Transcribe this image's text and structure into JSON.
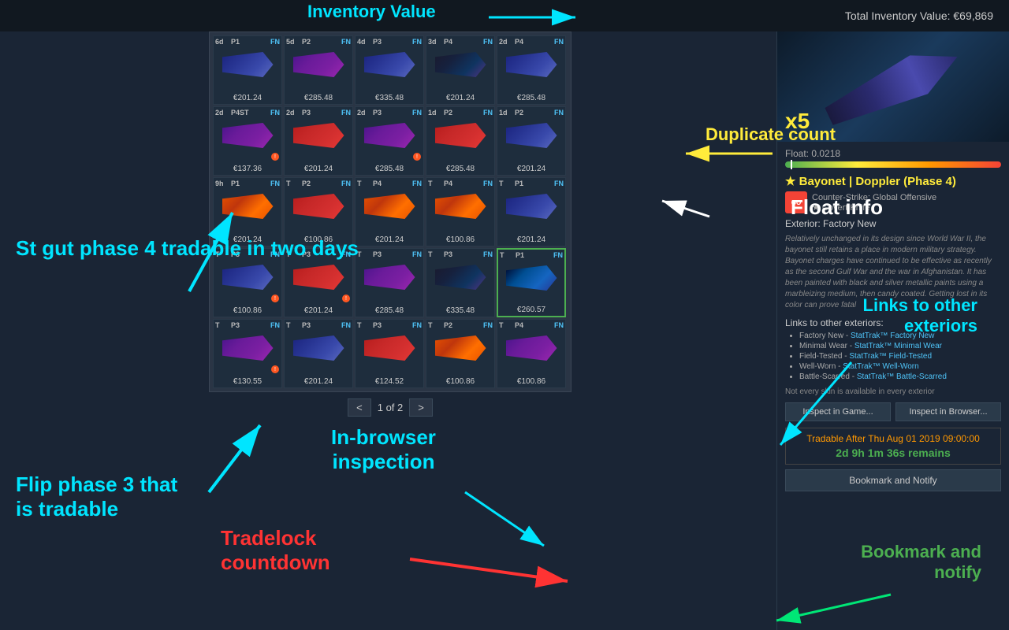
{
  "header": {
    "title": "Total Inventory Value: €69,869"
  },
  "annotations": {
    "inventory_value": "Inventory Value",
    "duplicate_count": "Duplicate count",
    "float_info": "Float info",
    "links_to_other": "Links to other\nexteriors",
    "st_gut": "St gut phase 4 tradable in two days",
    "flip_phase": "Flip phase 3 that\nis tradable",
    "inspection": "In-browser\ninspection",
    "tradelock": "Tradelock\ncountdown",
    "bookmark": "Bookmark and\nnotify"
  },
  "inventory": {
    "page_current": 1,
    "page_total": 2,
    "prev_label": "<",
    "next_label": ">",
    "items": [
      {
        "time": "6d",
        "phase": "P1",
        "wear": "FN",
        "price": "€201.24",
        "color": "blue"
      },
      {
        "time": "5d",
        "phase": "P2",
        "wear": "FN",
        "price": "€285.48",
        "color": "purple"
      },
      {
        "time": "4d",
        "phase": "P3",
        "wear": "FN",
        "price": "€335.48",
        "color": "blue"
      },
      {
        "time": "3d",
        "phase": "P4",
        "wear": "FN",
        "price": "€201.24",
        "color": "dark"
      },
      {
        "time": "2d",
        "phase": "P4",
        "wear": "FN",
        "price": "€285.48",
        "color": "blue"
      },
      {
        "time": "2d",
        "phase": "P4",
        "wear": "STFN",
        "price": "€137.36",
        "color": "purple",
        "warning": true
      },
      {
        "time": "2d",
        "phase": "P3",
        "wear": "FN",
        "price": "€201.24",
        "color": "red"
      },
      {
        "time": "2d",
        "phase": "P3",
        "wear": "FN",
        "price": "€285.48",
        "color": "purple",
        "warning": true
      },
      {
        "time": "1d",
        "phase": "P2",
        "wear": "FN",
        "price": "€285.48",
        "color": "red"
      },
      {
        "time": "1d",
        "phase": "P2",
        "wear": "FN",
        "price": "€201.24",
        "color": "blue"
      },
      {
        "time": "9h",
        "phase": "P1",
        "wear": "FN",
        "price": "€201.24",
        "color": "orange"
      },
      {
        "time": "T",
        "phase": "P2",
        "wear": "FN",
        "price": "€100.86",
        "color": "red"
      },
      {
        "time": "T",
        "phase": "P4",
        "wear": "FN",
        "price": "€201.24",
        "color": "orange"
      },
      {
        "time": "T",
        "phase": "P4",
        "wear": "FN",
        "price": "€100.86",
        "color": "orange"
      },
      {
        "time": "T",
        "phase": "P1",
        "wear": "FN",
        "price": "€201.24",
        "color": "blue"
      },
      {
        "time": "T",
        "phase": "P3",
        "wear": "FN",
        "price": "€100.86",
        "color": "blue",
        "warning": true
      },
      {
        "time": "T",
        "phase": "P3",
        "wear": "FN",
        "price": "€201.24",
        "color": "red",
        "warning": true
      },
      {
        "time": "T",
        "phase": "P3",
        "wear": "FN",
        "price": "€285.48",
        "color": "purple"
      },
      {
        "time": "T",
        "phase": "P3",
        "wear": "FN",
        "price": "€335.48",
        "color": "dark"
      },
      {
        "time": "T",
        "phase": "P1",
        "wear": "FN",
        "price": "€260.57",
        "color": "doppler",
        "selected": true
      },
      {
        "time": "T",
        "phase": "P3",
        "wear": "FN",
        "price": "€130.55",
        "color": "purple",
        "warning": true
      },
      {
        "time": "T",
        "phase": "P3",
        "wear": "FN",
        "price": "€201.24",
        "color": "blue"
      },
      {
        "time": "T",
        "phase": "P3",
        "wear": "FN",
        "price": "€124.52",
        "color": "red"
      },
      {
        "time": "T",
        "phase": "P2",
        "wear": "FN",
        "price": "€100.86",
        "color": "orange"
      },
      {
        "time": "T",
        "phase": "P4",
        "wear": "FN",
        "price": "€100.86",
        "color": "purple"
      }
    ]
  },
  "detail": {
    "duplicate_count": "x5",
    "float_label": "Float: 0.0218",
    "float_value": 0.0218,
    "float_marker_pct": 2.5,
    "item_name": "★ Bayonet | Doppler (Phase 4)",
    "game": "Counter-Strike: Global Offensive",
    "rarity": "★ Covert Knife",
    "exterior": "Exterior: Factory New",
    "description": "Relatively unchanged in its design since World War II, the bayonet still retains a place in modern military strategy. Bayonet charges have continued to be effective as recently as the second Gulf War and the war in Afghanistan. It has been painted with black and silver metallic paints using a marbleizing medium, then candy coated. Getting lost in its color can prove fatal",
    "links_title": "Links to other exteriors:",
    "links": [
      {
        "label": "Factory New",
        "st_label": "StatTrak™ Factory New"
      },
      {
        "label": "Minimal Wear",
        "st_label": "StatTrak™ Minimal Wear"
      },
      {
        "label": "Field-Tested",
        "st_label": "StatTrak™ Field-Tested"
      },
      {
        "label": "Well-Worn",
        "st_label": "StatTrak™ Well-Worn"
      },
      {
        "label": "Battle-Scarred",
        "st_label": "StatTrak™ Battle-Scarred"
      }
    ],
    "not_every_note": "Not every skin is available in every exterior",
    "inspect_game_btn": "Inspect in Game...",
    "inspect_browser_btn": "Inspect in Browser...",
    "tradable_date": "Tradable After Thu Aug 01 2019 09:00:00",
    "tradable_timer": "2d 9h 1m 36s remains",
    "bookmark_btn": "Bookmark and Notify"
  }
}
